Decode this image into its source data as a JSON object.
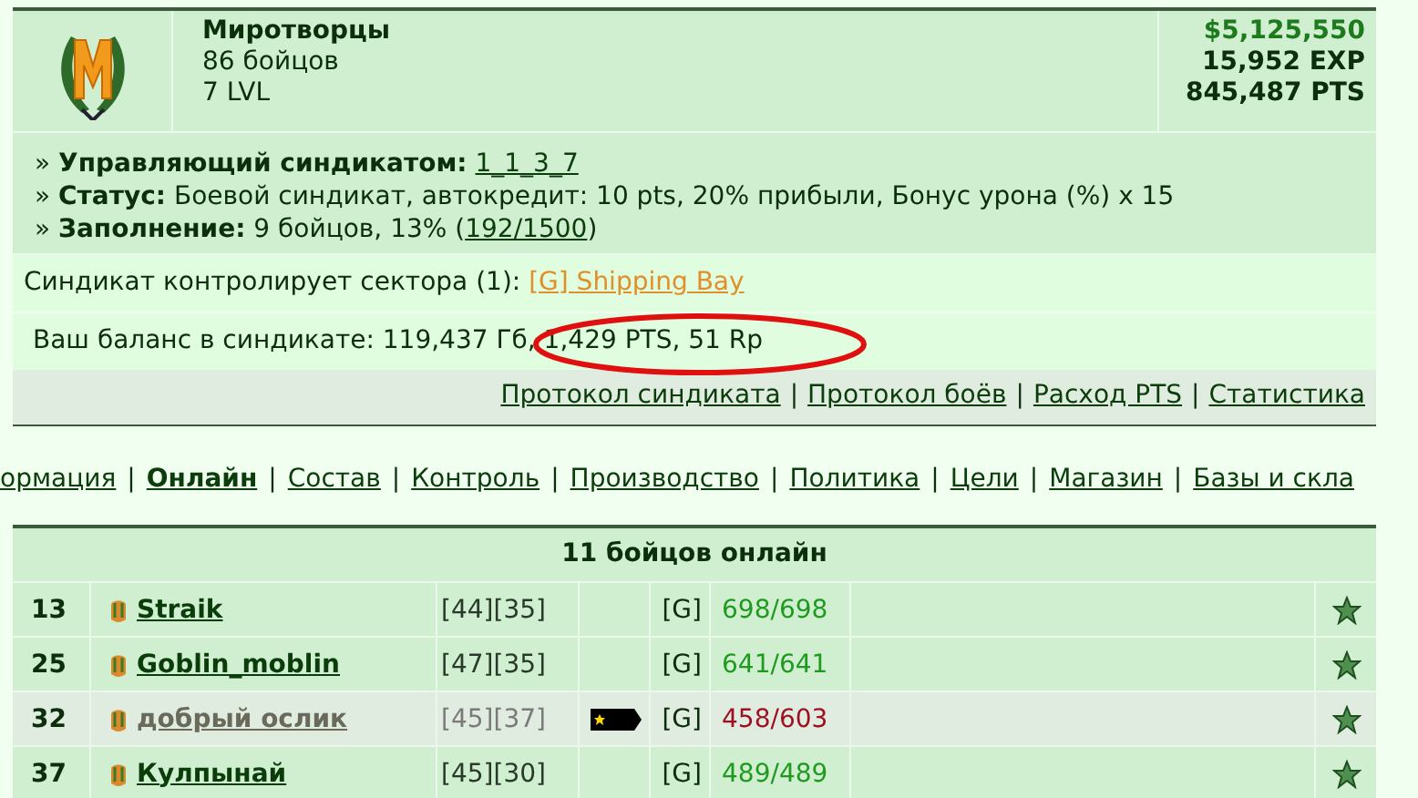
{
  "syndicate": {
    "name": "Миротворцы",
    "members": "86 бойцов",
    "level": "7 LVL",
    "money": "$5,125,550",
    "exp": "15,952 EXP",
    "pts": "845,487 PTS"
  },
  "info": [
    {
      "bullet": "»",
      "label": "Управляющий синдикатом:",
      "link": "1_1_3_7"
    },
    {
      "bullet": "»",
      "label": "Статус:",
      "before": "Боевой синдикат, автокредит: 10 pts, 20% прибыли, Бонус урона (%) x 15"
    },
    {
      "bullet": "»",
      "label": "Заполнение:",
      "before": "9 бойцов, 13% (",
      "link": "192/1500",
      "after": ")"
    }
  ],
  "sectors": {
    "text": "Синдикат контролирует сектора (1):",
    "link": "[G] Shipping Bay"
  },
  "balance": {
    "text": "Ваш баланс в синдикате: 119,437 Гб, 1,429 PTS, 51 Rp",
    "circled": true
  },
  "links": {
    "separator": "|",
    "items": [
      "Протокол синдиката",
      "Протокол боёв",
      "Расход PTS",
      "Статистика"
    ]
  },
  "nav": {
    "separator": "|",
    "items": [
      {
        "label": "ормация",
        "selected": false
      },
      {
        "label": "Онлайн",
        "selected": true
      },
      {
        "label": "Состав",
        "selected": false
      },
      {
        "label": "Контроль",
        "selected": false
      },
      {
        "label": "Производство",
        "selected": false
      },
      {
        "label": "Политика",
        "selected": false
      },
      {
        "label": "Цели",
        "selected": false
      },
      {
        "label": "Магазин",
        "selected": false
      },
      {
        "label": "Базы и скла",
        "selected": false
      }
    ]
  },
  "online": {
    "title": "11 бойцов онлайн",
    "rows": [
      {
        "rank": "13",
        "name": "Straik",
        "coords": "[44][35]",
        "badge": false,
        "group": "[G]",
        "hp": "698/698",
        "hp_full": true,
        "highlighted": false
      },
      {
        "rank": "25",
        "name": "Goblin_moblin",
        "coords": "[47][35]",
        "badge": false,
        "group": "[G]",
        "hp": "641/641",
        "hp_full": true,
        "highlighted": false
      },
      {
        "rank": "32",
        "name": "добрый ослик",
        "coords": "[45][37]",
        "badge": true,
        "group": "[G]",
        "hp": "458/603",
        "hp_full": false,
        "highlighted": true
      },
      {
        "rank": "37",
        "name": "Кулпынай",
        "coords": "[45][30]",
        "badge": false,
        "group": "[G]",
        "hp": "489/489",
        "hp_full": true,
        "highlighted": false
      }
    ]
  }
}
